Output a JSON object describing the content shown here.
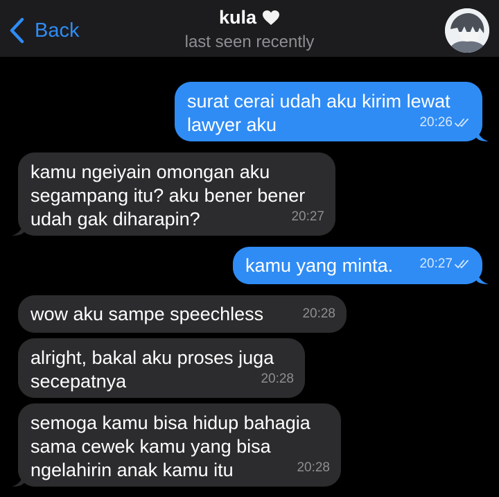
{
  "header": {
    "back_label": "Back",
    "contact_name": "kula",
    "status": "last seen recently"
  },
  "colors": {
    "accent": "#2f8cf5",
    "outgoing_bubble": "#2f8cf5",
    "incoming_bubble": "#2c2c2e",
    "header_bg": "#1c1c1e",
    "background": "#000000"
  },
  "messages": [
    {
      "direction": "outgoing",
      "text": "surat cerai udah aku kirim lewat\nlawyer aku",
      "time": "20:26",
      "read": true
    },
    {
      "direction": "incoming",
      "text": "kamu ngeiyain omongan aku\nsegampang itu? aku bener bener\nudah gak diharapin?",
      "time": "20:27"
    },
    {
      "direction": "outgoing",
      "text": "kamu yang minta.",
      "time": "20:27",
      "read": true
    },
    {
      "direction": "incoming",
      "text": "wow aku sampe speechless",
      "time": "20:28"
    },
    {
      "direction": "incoming",
      "text": "alright, bakal aku proses juga\nsecepatnya",
      "time": "20:28"
    },
    {
      "direction": "incoming",
      "text": "semoga kamu bisa hidup bahagia\nsama cewek kamu yang bisa\nngelahirin anak kamu itu",
      "time": "20:28"
    }
  ]
}
